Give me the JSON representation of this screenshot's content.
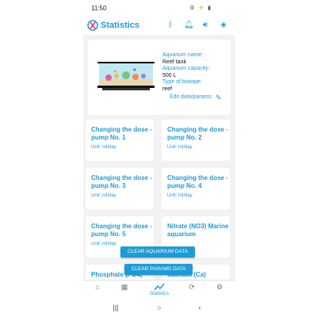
{
  "status": {
    "time": "11:50",
    "icons": "⚙ ⚡ ▮"
  },
  "app": {
    "title": "Statistics"
  },
  "aquarium": {
    "name_label": "Aquarium name:",
    "name_value": "Reef tank",
    "capacity_label": "Aquarium capacity:",
    "capacity_value": "500 L",
    "biotope_label": "Type of biotope:",
    "biotope_value": "reef",
    "edit_label": "Edit data/params"
  },
  "tiles": [
    {
      "title": "Changing the dose - pump No. 1",
      "unit": "Unit:  ml/day"
    },
    {
      "title": "Changing the dose - pump No. 2",
      "unit": "Unit:  ml/day"
    },
    {
      "title": "Changing the dose - pump No. 3",
      "unit": "Unit:  ml/day"
    },
    {
      "title": "Changing the dose - pump No. 4",
      "unit": "Unit:  ml/day"
    },
    {
      "title": "Changing the dose - pump No. 5",
      "unit": "Unit:  ml/day"
    },
    {
      "title": "Nitrate (NO3) Marine aquarium",
      "unit": ""
    },
    {
      "title": "Phosphate (PO4)",
      "unit": ""
    },
    {
      "title": "Calcium (Ca)",
      "unit": ""
    }
  ],
  "buttons": {
    "clear_aquarium": "CLEAR AQUARIUM DATA",
    "clear_params": "CLEAR PARAMS DATA"
  },
  "bottom_nav": {
    "active_label": "Statistics"
  },
  "colors": {
    "accent": "#1e9bd7"
  }
}
